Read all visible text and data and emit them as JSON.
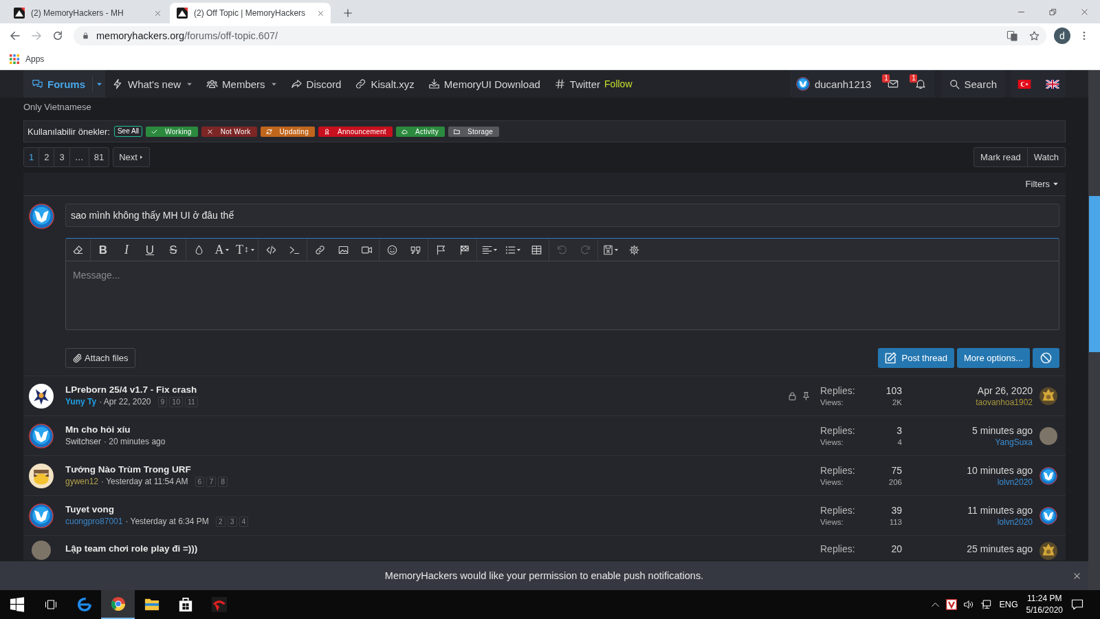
{
  "browser": {
    "tabs": [
      {
        "title": "(2) MemoryHackers - MH",
        "selected": false
      },
      {
        "title": "(2) Off Topic | MemoryHackers",
        "selected": true
      }
    ],
    "address": {
      "domain": "memoryhackers.org",
      "path": "/forums/off-topic.607/"
    },
    "profile": "d",
    "bookmarks": [
      {
        "label": "Apps",
        "kind": "apps"
      }
    ]
  },
  "nav": {
    "items": [
      {
        "kind": "comments",
        "label": "Forums",
        "selected": true,
        "dropdown": true
      },
      {
        "kind": "bolt",
        "label": "What's new",
        "selected": false,
        "dropdown": true
      },
      {
        "kind": "users",
        "label": "Members",
        "selected": false,
        "dropdown": true
      },
      {
        "kind": "share",
        "label": "Discord",
        "selected": false,
        "dropdown": false
      },
      {
        "kind": "link",
        "label": "Kisalt.xyz",
        "selected": false,
        "dropdown": false
      },
      {
        "kind": "download",
        "label": "MemoryUI Download",
        "selected": false,
        "dropdown": false
      },
      {
        "kind": "hash",
        "label": "Twitter",
        "suffix": "Follow",
        "selected": false,
        "dropdown": false
      }
    ],
    "user": {
      "name": "ducanh1213",
      "avatar": {
        "kind": "logo"
      }
    },
    "inbox_badge": "1",
    "alerts_badge": "1",
    "search": "Search",
    "languages": [
      {
        "kind": "turkish"
      },
      {
        "kind": "british"
      }
    ]
  },
  "forum": {
    "description": "Only Vietnamese"
  },
  "prefixes": {
    "label": "Kullanılabilir önekler:",
    "see_all": "See All",
    "items": [
      {
        "label": "Working",
        "kind": "check",
        "color": "#2b8a3e"
      },
      {
        "label": "Not Work",
        "kind": "cross",
        "color": "#7c2626"
      },
      {
        "label": "Updating",
        "kind": "refresh",
        "color": "#c0661c"
      },
      {
        "label": "Announcement",
        "kind": "ribbon",
        "color": "#c8101e"
      },
      {
        "label": "Activity",
        "kind": "cloud",
        "color": "#2b8a3e"
      },
      {
        "label": "Storage",
        "kind": "folder",
        "color": "#56585c"
      }
    ]
  },
  "pagination": {
    "pages": [
      {
        "label": "1",
        "selected": true
      },
      {
        "label": "2",
        "selected": false
      },
      {
        "label": "3",
        "selected": false
      },
      {
        "label": "…",
        "selected": false
      },
      {
        "label": "81",
        "selected": false
      }
    ],
    "next": "Next"
  },
  "actions": [
    "Mark read",
    "Watch"
  ],
  "filters": "Filters",
  "quick_thread": {
    "avatar": {
      "kind": "logo"
    },
    "title": "sao mình không thấy MH UI ở đâu thế",
    "toolbar": [
      [
        {
          "kind": "eraser",
          "disabled": false,
          "dropdown": false
        }
      ],
      [
        {
          "kind": "bold",
          "label": "B",
          "disabled": false,
          "dropdown": false
        },
        {
          "kind": "italic",
          "label": "I",
          "disabled": false,
          "dropdown": false
        },
        {
          "kind": "underline",
          "label": "U",
          "disabled": false,
          "dropdown": false
        },
        {
          "kind": "strike",
          "label": "S",
          "disabled": false,
          "dropdown": false
        }
      ],
      [
        {
          "kind": "drop",
          "disabled": false,
          "dropdown": false
        },
        {
          "kind": "font",
          "label": "A",
          "disabled": false,
          "dropdown": true
        },
        {
          "kind": "size",
          "label": "T",
          "disabled": false,
          "dropdown": true
        }
      ],
      [
        {
          "kind": "code",
          "disabled": false,
          "dropdown": false
        },
        {
          "kind": "terminal",
          "disabled": false,
          "dropdown": false
        }
      ],
      [
        {
          "kind": "link",
          "disabled": false,
          "dropdown": false
        },
        {
          "kind": "image",
          "disabled": false,
          "dropdown": false
        },
        {
          "kind": "video",
          "disabled": false,
          "dropdown": false
        }
      ],
      [
        {
          "kind": "smiley",
          "disabled": false,
          "dropdown": false
        },
        {
          "kind": "quote",
          "disabled": false,
          "dropdown": false
        }
      ],
      [
        {
          "kind": "flag",
          "disabled": false,
          "dropdown": false
        },
        {
          "kind": "checkered",
          "disabled": false,
          "dropdown": false
        }
      ],
      [
        {
          "kind": "align",
          "disabled": false,
          "dropdown": true
        },
        {
          "kind": "list",
          "disabled": false,
          "dropdown": true
        },
        {
          "kind": "table",
          "disabled": false,
          "dropdown": false
        }
      ],
      [
        {
          "kind": "undo",
          "disabled": true,
          "dropdown": false
        },
        {
          "kind": "redo",
          "disabled": true,
          "dropdown": false
        }
      ],
      [
        {
          "kind": "save",
          "disabled": false,
          "dropdown": true
        },
        {
          "kind": "gear",
          "disabled": false,
          "dropdown": false
        }
      ]
    ],
    "placeholder": "Message...",
    "attach": "Attach files",
    "buttons": [
      {
        "kind": "post",
        "label": "Post thread"
      },
      {
        "kind": "more",
        "label": "More options..."
      },
      {
        "kind": "cancel"
      }
    ]
  },
  "threads": [
    {
      "title": "LPreborn 25/4 v1.7 - Fix crash",
      "avatar": {
        "kind": "cartoon"
      },
      "author": {
        "name": "Yuny Ty",
        "color": "#1ea0e6",
        "bold": true
      },
      "date": "· Apr 22, 2020",
      "pages": [
        "9",
        "10",
        "11"
      ],
      "locked": true,
      "sticky": true,
      "stats": [
        {
          "label": "Replies:",
          "value": "103"
        },
        {
          "label": "Views:",
          "value": "2K"
        }
      ],
      "last": {
        "date": "Apr 26, 2020",
        "user": {
          "name": "taovanhoa1902",
          "color": "#a6963c"
        },
        "avatar": {
          "kind": "gold"
        }
      }
    },
    {
      "title": "Mn cho hỏi xíu",
      "avatar": {
        "kind": "logo"
      },
      "author": {
        "name": "Switchser",
        "color": "#d0d0d0",
        "bold": false
      },
      "date": "· 20 minutes ago",
      "locked": false,
      "sticky": false,
      "stats": [
        {
          "label": "Replies:",
          "value": "3"
        },
        {
          "label": "Views:",
          "value": "4"
        }
      ],
      "last": {
        "date": "5 minutes ago",
        "user": {
          "name": "YangSuxa",
          "color": "#3a8fd6"
        },
        "avatar": {
          "kind": "photo"
        }
      }
    },
    {
      "title": "Tướng Nào Trùm Trong URF",
      "avatar": {
        "kind": "character"
      },
      "author": {
        "name": "gywen12",
        "color": "#b3a34a",
        "bold": false
      },
      "date": "· Yesterday at 11:54 AM",
      "pages": [
        "6",
        "7",
        "8"
      ],
      "locked": false,
      "sticky": false,
      "stats": [
        {
          "label": "Replies:",
          "value": "75"
        },
        {
          "label": "Views:",
          "value": "206"
        }
      ],
      "last": {
        "date": "10 minutes ago",
        "user": {
          "name": "lolvn2020",
          "color": "#3a8fd6"
        },
        "avatar": {
          "kind": "logo"
        }
      }
    },
    {
      "title": "Tuyet vong",
      "avatar": {
        "kind": "logo"
      },
      "author": {
        "name": "cuongpro87001",
        "color": "#3a86c8",
        "bold": false
      },
      "date": "· Yesterday at 6:34 PM",
      "pages": [
        "2",
        "3",
        "4"
      ],
      "locked": false,
      "sticky": false,
      "stats": [
        {
          "label": "Replies:",
          "value": "39"
        },
        {
          "label": "Views:",
          "value": "113"
        }
      ],
      "last": {
        "date": "11 minutes ago",
        "user": {
          "name": "lolvn2020",
          "color": "#3a8fd6"
        },
        "avatar": {
          "kind": "logo"
        }
      }
    },
    {
      "title": "Lập team chơi role play đi =)))",
      "avatar": {
        "kind": "photo"
      },
      "locked": false,
      "sticky": false,
      "stats": [
        {
          "label": "Replies:",
          "value": "20"
        }
      ],
      "last": {
        "date": "25 minutes ago",
        "avatar": {
          "kind": "gold"
        }
      }
    }
  ],
  "notification": "MemoryHackers would like your permission to enable push notifications.",
  "taskbar": {
    "apps": [
      {
        "kind": "e-browser",
        "selected": false
      },
      {
        "kind": "round-browser",
        "selected": true
      },
      {
        "kind": "folder",
        "selected": false
      },
      {
        "kind": "bag",
        "selected": false
      },
      {
        "kind": "app",
        "selected": false
      }
    ],
    "language": "ENG",
    "time": "11:24 PM",
    "date": "5/16/2020"
  }
}
